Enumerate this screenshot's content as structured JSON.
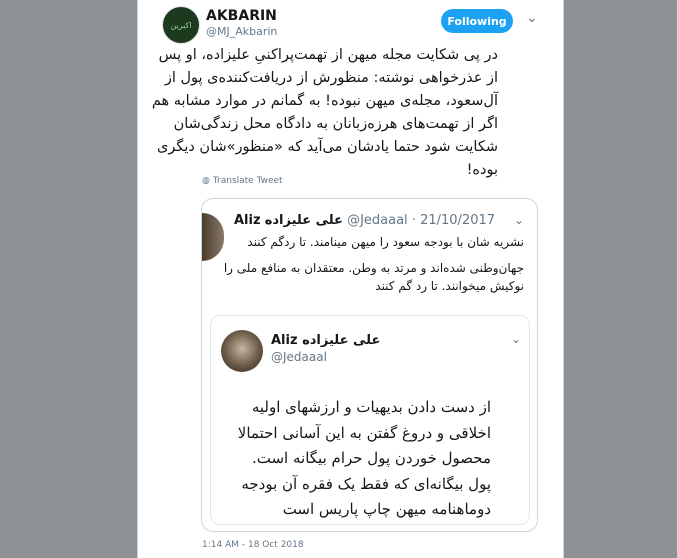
{
  "author": {
    "name": "AKBARIN",
    "handle": "@MJ_Akbarin",
    "avatar_text": "اکبرین",
    "follow_label": "Following"
  },
  "tweet": {
    "text": "در پی شکایت مجله میهن از تهمت‌پراکنیِ علیزاده، او پس از عذرخواهی نوشته: منظورش از دریافت‌کننده‌ی پول از آل‌سعود، مجله‌ی میهن نبوده! به گمانم در موارد مشابه هم اگر از تهمت‌های هرزه‌زبانان به دادگاه محل زندگی‌شان شکایت شود حتما یادشان می‌آید که «منظور»شان دیگری بوده!",
    "translate_label": "Translate Tweet",
    "timestamp": "1:14 AM - 18 Oct 2018"
  },
  "quoted": {
    "name_latin": "Aliz",
    "name_fa": "علی علیزاده",
    "handle": "@Jedaaal",
    "date": "21/10/2017",
    "line1": "نشریه شان با بودجه سعود را میهن مینامند. تا ردگم کنند",
    "line2": "جهان‌وطنی شده‌اند و مرتد به وطن. معتقدان به منافع ملی را نوکیش میخوانند. تا رد گم کنند",
    "inner": {
      "name_latin": "Aliz",
      "name_fa": "علی علیزاده",
      "handle": "@Jedaaal",
      "text": "از دست دادن بدیهیات و ارزشهای اولیه اخلاقی و دروغ گفتن به این آسانی احتمالا محصول خوردن پول حرام بیگانه است. پول بیگانه‌ای که فقط یک فقره آن بودجه دوماهنامه میهن چاپ پاریس است"
    }
  },
  "icons": {
    "chevron": "chevron-down-icon",
    "globe": "globe-icon"
  },
  "colors": {
    "accent": "#1da1f2",
    "muted": "#657786",
    "text": "#14171a"
  }
}
